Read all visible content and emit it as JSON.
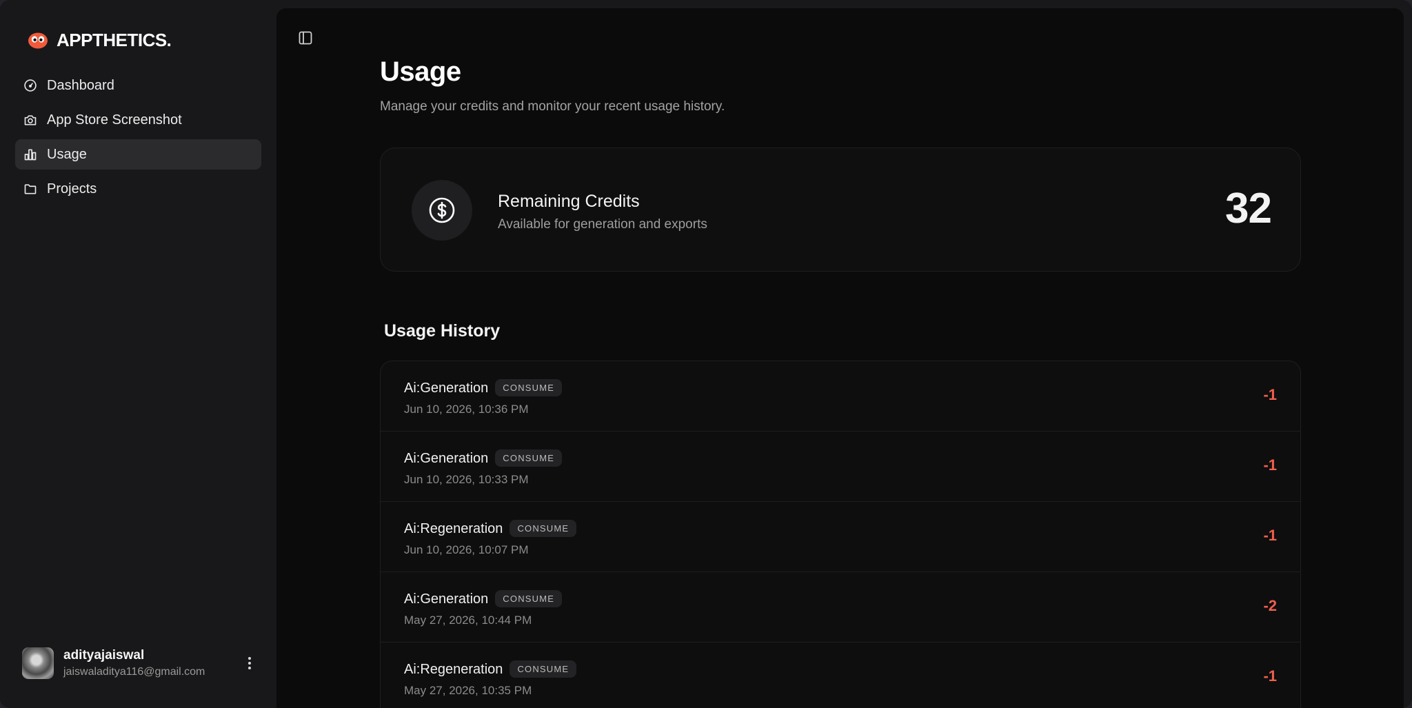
{
  "brand": {
    "name": "APPTHETICS."
  },
  "nav": {
    "items": [
      {
        "label": "Dashboard",
        "icon": "gauge-icon"
      },
      {
        "label": "App Store Screenshot",
        "icon": "camera-icon"
      },
      {
        "label": "Usage",
        "icon": "bar-chart-icon",
        "active": true
      },
      {
        "label": "Projects",
        "icon": "folder-icon"
      }
    ]
  },
  "user": {
    "name": "adityajaiswal",
    "email": "jaiswaladitya116@gmail.com"
  },
  "page": {
    "title": "Usage",
    "subtitle": "Manage your credits and monitor your recent usage history."
  },
  "credits": {
    "title": "Remaining Credits",
    "subtitle": "Available for generation and exports",
    "value": "32",
    "icon": "dollar-circle-icon"
  },
  "history": {
    "title": "Usage History",
    "rows": [
      {
        "name": "Ai:Generation",
        "badge": "CONSUME",
        "date": "Jun 10, 2026, 10:36 PM",
        "amount": "-1"
      },
      {
        "name": "Ai:Generation",
        "badge": "CONSUME",
        "date": "Jun 10, 2026, 10:33 PM",
        "amount": "-1"
      },
      {
        "name": "Ai:Regeneration",
        "badge": "CONSUME",
        "date": "Jun 10, 2026, 10:07 PM",
        "amount": "-1"
      },
      {
        "name": "Ai:Generation",
        "badge": "CONSUME",
        "date": "May 27, 2026, 10:44 PM",
        "amount": "-2"
      },
      {
        "name": "Ai:Regeneration",
        "badge": "CONSUME",
        "date": "May 27, 2026, 10:35 PM",
        "amount": "-1"
      }
    ]
  },
  "colors": {
    "accent_negative": "#f0604c",
    "logo": "#ef5a3c"
  }
}
